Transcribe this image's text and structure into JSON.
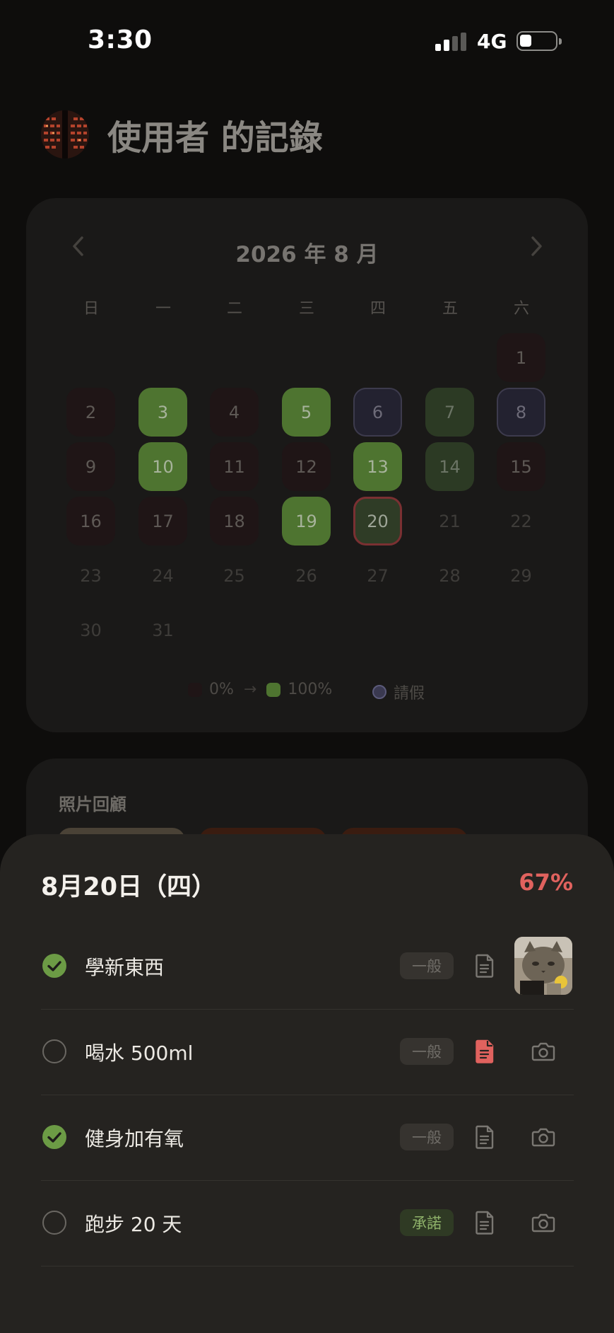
{
  "status_bar": {
    "time": "3:30",
    "network": "4G"
  },
  "header": {
    "title": "使用者 的記錄"
  },
  "calendar": {
    "month_label": "2026 年 8 月",
    "weekdays": [
      "日",
      "一",
      "二",
      "三",
      "四",
      "五",
      "六"
    ],
    "days": [
      {
        "label": "1",
        "state": "low"
      },
      {
        "label": "2",
        "state": "low"
      },
      {
        "label": "3",
        "state": "full"
      },
      {
        "label": "4",
        "state": "low"
      },
      {
        "label": "5",
        "state": "full"
      },
      {
        "label": "6",
        "state": "leave"
      },
      {
        "label": "7",
        "state": "partial"
      },
      {
        "label": "8",
        "state": "leave"
      },
      {
        "label": "9",
        "state": "low"
      },
      {
        "label": "10",
        "state": "full"
      },
      {
        "label": "11",
        "state": "low"
      },
      {
        "label": "12",
        "state": "low"
      },
      {
        "label": "13",
        "state": "full"
      },
      {
        "label": "14",
        "state": "partial"
      },
      {
        "label": "15",
        "state": "low"
      },
      {
        "label": "16",
        "state": "low"
      },
      {
        "label": "17",
        "state": "low"
      },
      {
        "label": "18",
        "state": "low"
      },
      {
        "label": "19",
        "state": "full"
      },
      {
        "label": "20",
        "state": "today"
      },
      {
        "label": "21",
        "state": "future"
      },
      {
        "label": "22",
        "state": "future"
      },
      {
        "label": "23",
        "state": "future"
      },
      {
        "label": "24",
        "state": "future"
      },
      {
        "label": "25",
        "state": "future"
      },
      {
        "label": "26",
        "state": "future"
      },
      {
        "label": "27",
        "state": "future"
      },
      {
        "label": "28",
        "state": "future"
      },
      {
        "label": "29",
        "state": "future"
      },
      {
        "label": "30",
        "state": "future"
      },
      {
        "label": "31",
        "state": "future"
      }
    ],
    "legend": {
      "low_label": "0%",
      "arrow": "→",
      "high_label": "100%",
      "leave_label": "請假"
    },
    "colors": {
      "low": "#1f1516",
      "full": "#4e7430",
      "leave": "#5b5a7a"
    }
  },
  "photos": {
    "title": "照片回顧"
  },
  "sheet": {
    "date": "8月20日（四）",
    "percent": "67%",
    "tasks": [
      {
        "label": "學新東西",
        "done": true,
        "tag": "一般",
        "note": false,
        "has_photo": true
      },
      {
        "label": "喝水 500ml",
        "done": false,
        "tag": "一般",
        "note": true,
        "has_photo": false
      },
      {
        "label": "健身加有氧",
        "done": true,
        "tag": "一般",
        "note": false,
        "has_photo": false
      },
      {
        "label": "跑步 20 天",
        "done": false,
        "tag": "承諾",
        "note": false,
        "has_photo": false
      }
    ]
  }
}
